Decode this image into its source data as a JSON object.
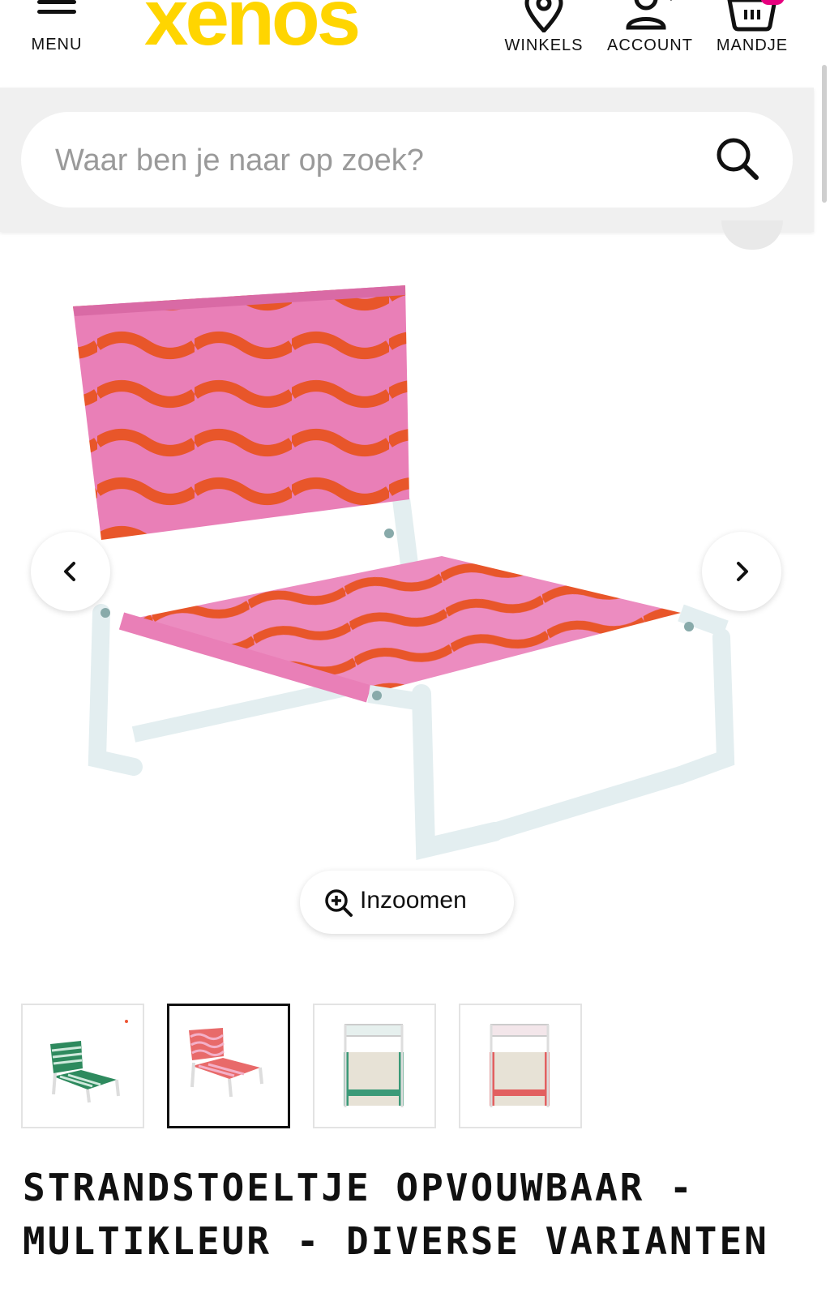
{
  "header": {
    "menu_label": "MENU",
    "logo_text": "xenos",
    "logo_color": "#ffd500",
    "nav": [
      {
        "label": "WINKELS",
        "icon": "location-pin-icon"
      },
      {
        "label": "ACCOUNT",
        "icon": "user-icon"
      },
      {
        "label": "MANDJE",
        "icon": "basket-icon"
      }
    ],
    "badge_color": "#e6007e"
  },
  "search": {
    "placeholder": "Waar ben je naar op zoek?",
    "icon": "search-icon"
  },
  "gallery": {
    "prev_icon": "chevron-left-icon",
    "next_icon": "chevron-right-icon",
    "zoom_label": "Inzoomen",
    "zoom_icon": "zoom-in-icon",
    "thumbnails": [
      {
        "variant": "green-striped",
        "active": false
      },
      {
        "variant": "pink-wave",
        "active": true
      },
      {
        "variant": "green-folded",
        "active": false
      },
      {
        "variant": "red-folded",
        "active": false
      }
    ]
  },
  "product": {
    "title_line1": "STRANDSTOELTJE OPVOUWBAAR -",
    "title_line2": "MULTIKLEUR - DIVERSE VARIANTEN"
  }
}
